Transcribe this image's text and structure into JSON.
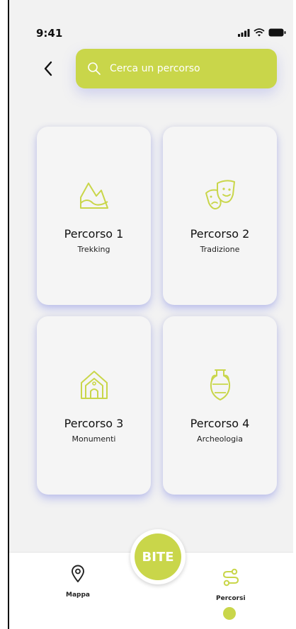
{
  "status_bar": {
    "time": "9:41",
    "icons": [
      "signal-icon",
      "wifi-icon",
      "battery-icon"
    ]
  },
  "header": {
    "back_icon": "chevron-left-icon",
    "search_placeholder": "Cerca un percorso",
    "search_value": ""
  },
  "cards": [
    {
      "title": "Percorso 1",
      "subtitle": "Trekking",
      "icon": "mountain-icon"
    },
    {
      "title": "Percorso 2",
      "subtitle": "Tradizione",
      "icon": "theater-masks-icon"
    },
    {
      "title": "Percorso 3",
      "subtitle": "Monumenti",
      "icon": "church-icon"
    },
    {
      "title": "Percorso 4",
      "subtitle": "Archeologia",
      "icon": "amphora-icon"
    }
  ],
  "bottom_nav": {
    "left": {
      "label": "Mappa",
      "icon": "map-pin-icon"
    },
    "center": {
      "logo": "BITE"
    },
    "right": {
      "label": "Percorsi",
      "icon": "route-icon",
      "active": true
    }
  },
  "colors": {
    "accent": "#c9d64a",
    "background": "#f2f2f2",
    "card": "#f5f5f5",
    "shadow": "#8c91e6"
  }
}
